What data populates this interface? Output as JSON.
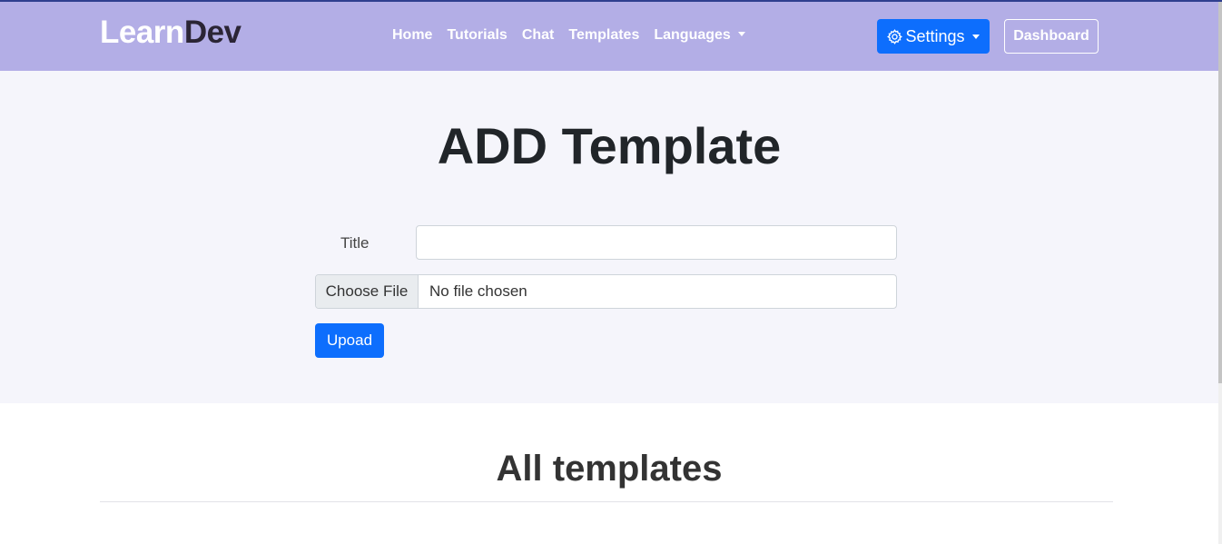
{
  "brand": {
    "part1": "Learn",
    "part2": "Dev"
  },
  "nav": {
    "items": [
      {
        "label": "Home"
      },
      {
        "label": "Tutorials"
      },
      {
        "label": "Chat"
      },
      {
        "label": "Templates"
      },
      {
        "label": "Languages"
      }
    ],
    "settings_label": "Settings",
    "settings_icon": "gear-icon",
    "dashboard_label": "Dashboard"
  },
  "hero": {
    "title": "ADD Template",
    "title_label": "Title",
    "title_value": "",
    "file_button": "Choose File",
    "file_status": "No file chosen",
    "upload_label": "Upoad"
  },
  "templates_section": {
    "title": "All templates"
  },
  "colors": {
    "navbar": "#b3aee6",
    "primary": "#0d6efd",
    "hero_bg": "#f5f5fb",
    "brand_dark": "#2b2535"
  }
}
